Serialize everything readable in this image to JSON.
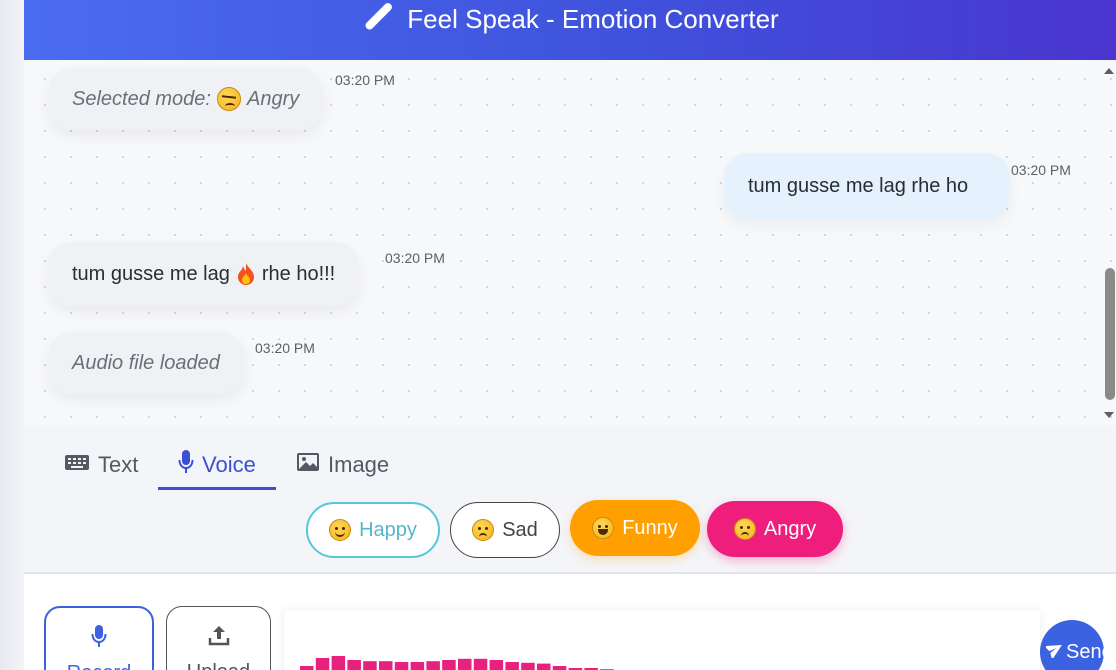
{
  "header": {
    "title": "Feel Speak - Emotion Converter",
    "icon": "brush-icon"
  },
  "messages": [
    {
      "role": "system",
      "text_before": "Selected mode:",
      "emoji": "angry-face",
      "text_after": "Angry",
      "time": "03:20 PM"
    },
    {
      "role": "user",
      "text": "tum gusse me lag rhe ho",
      "time": "03:20 PM"
    },
    {
      "role": "bot",
      "text_before": "tum gusse me lag",
      "emoji": "fire",
      "text_after": "rhe ho!!!",
      "time": "03:20 PM"
    },
    {
      "role": "system",
      "text": "Audio file loaded",
      "time": "03:20 PM"
    }
  ],
  "tabs": [
    {
      "label": "Text",
      "icon": "keyboard-icon",
      "active": false
    },
    {
      "label": "Voice",
      "icon": "microphone-icon",
      "active": true
    },
    {
      "label": "Image",
      "icon": "image-icon",
      "active": false
    }
  ],
  "moods": [
    {
      "label": "Happy",
      "icon": "smiling-face",
      "color": "#56c6da"
    },
    {
      "label": "Sad",
      "icon": "sad-face",
      "color": "#444444"
    },
    {
      "label": "Funny",
      "icon": "laughing-face",
      "color": "#ff9f00"
    },
    {
      "label": "Angry",
      "icon": "angry-face",
      "color": "#ef1e7c"
    }
  ],
  "controls": {
    "record_label": "Record",
    "upload_label": "Upload",
    "send_label": "Send"
  },
  "waveform": {
    "color": "#e8207e",
    "levels": [
      0.6,
      0.8,
      0.85,
      0.75,
      0.72,
      0.72,
      0.7,
      0.7,
      0.72,
      0.75,
      0.78,
      0.78,
      0.75,
      0.7,
      0.68,
      0.66,
      0.6,
      0.55,
      0.55,
      0.52,
      0.5,
      0.48,
      0.5,
      0.45,
      0.42,
      0.4,
      0.38,
      0.36,
      0.35,
      0.4,
      0.38,
      0.36,
      0.34,
      0.3,
      0.3,
      0.28,
      0.27,
      0.25,
      0.24,
      0.22,
      0.22,
      0.2,
      0.18,
      0.16,
      0.14,
      0.13,
      0.12,
      0.1
    ]
  },
  "colors": {
    "accent": "#3b4fd6",
    "header_start": "#4a6cf0",
    "header_end": "#4a35cf"
  }
}
